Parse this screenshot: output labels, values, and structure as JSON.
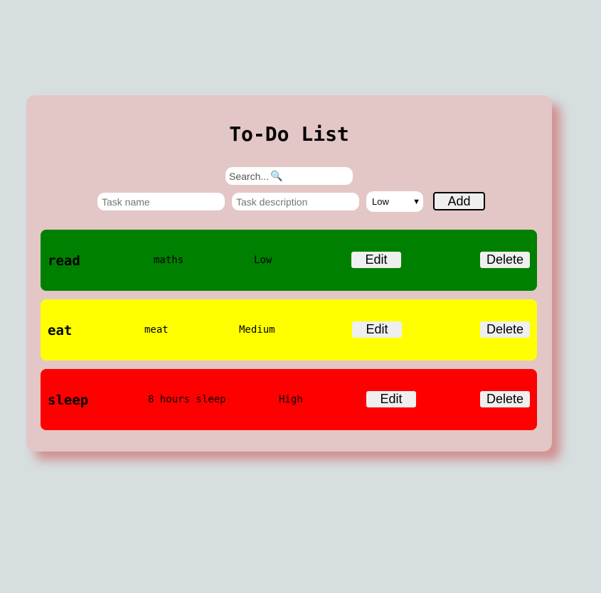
{
  "app": {
    "title": "To-Do List"
  },
  "search": {
    "placeholder": "Search...",
    "icon": "magnifier-icon"
  },
  "form": {
    "task_name_placeholder": "Task name",
    "task_description_placeholder": "Task description",
    "priority_selected": "Low",
    "add_label": "Add"
  },
  "tasks": [
    {
      "name": "read",
      "description": "maths",
      "priority": "Low",
      "color": "#008000",
      "edit_label": "Edit",
      "delete_label": "Delete"
    },
    {
      "name": "eat",
      "description": "meat",
      "priority": "Medium",
      "color": "#ffff00",
      "edit_label": "Edit",
      "delete_label": "Delete"
    },
    {
      "name": "sleep",
      "description": "8 hours sleep",
      "priority": "High",
      "color": "#ff0000",
      "edit_label": "Edit",
      "delete_label": "Delete"
    }
  ]
}
